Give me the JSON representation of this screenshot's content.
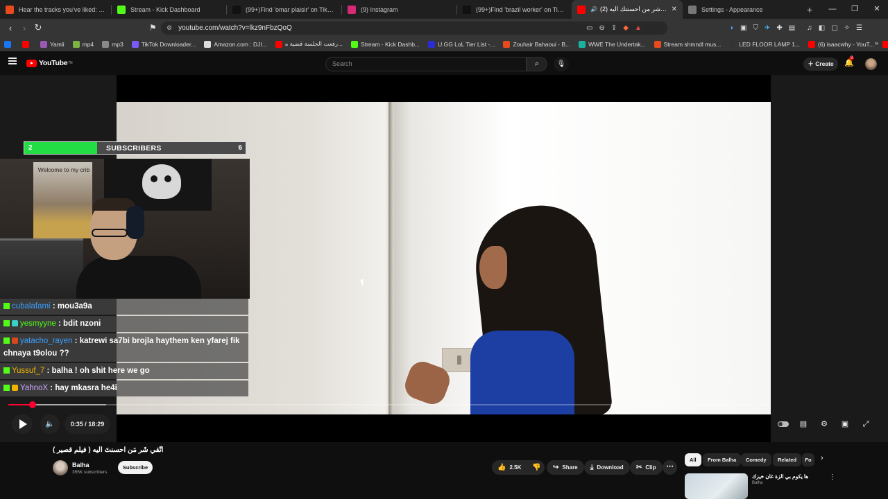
{
  "browser": {
    "tabs": [
      {
        "title": "Hear the tracks you've liked: on Sou",
        "color": "#e8491d",
        "active": false
      },
      {
        "title": "Stream - Kick Dashboard",
        "color": "#53fc18",
        "active": false
      },
      {
        "title": "(99+)Find 'omar plaisir' on TikTok | T",
        "color": "#111111",
        "active": false
      },
      {
        "title": "(9) Instagram",
        "color": "#d62976",
        "active": false
      },
      {
        "title": "(99+)Find 'brazil worker' on TikTok |",
        "color": "#111111",
        "active": false
      },
      {
        "title": "(2) القي شر من احسنتك اليه (",
        "color": "#ff0000",
        "active": true
      },
      {
        "title": "Settings - Appearance",
        "color": "#777777",
        "active": false
      }
    ],
    "new_tab_label": "+",
    "window_controls": [
      "—",
      "❐",
      "✕"
    ],
    "url": "youtube.com/watch?v=lkz9nFbzQoQ",
    "bookmarks": [
      {
        "label": "",
        "color": "#1877f2"
      },
      {
        "label": "",
        "color": "#ff0000"
      },
      {
        "label": "Yamli",
        "color": "#9b59b6"
      },
      {
        "label": "mp4",
        "color": "#7cb342"
      },
      {
        "label": "mp3",
        "color": "#888888"
      },
      {
        "label": "TikTok Downloader...",
        "color": "#7a5af8"
      },
      {
        "label": "Amazon.com : DJI...",
        "color": "#dddddd"
      },
      {
        "label": "رفعت الجلسة قضية ه...",
        "color": "#ff0000"
      },
      {
        "label": "Stream - Kick Dashb...",
        "color": "#53fc18"
      },
      {
        "label": "U.GG LoL Tier List -...",
        "color": "#2b2bd8"
      },
      {
        "label": "Zouhair Bahaoui - B...",
        "color": "#e8491d"
      },
      {
        "label": "WWE The Undertak...",
        "color": "#19b3a0"
      },
      {
        "label": "Stream shmndl mus...",
        "color": "#e8491d"
      },
      {
        "label": "LED FLOOR LAMP 1...",
        "color": "#333333"
      },
      {
        "label": "(6) isaacwhy - YouT...",
        "color": "#ff0000"
      },
      {
        "label": "st",
        "color": "#ff0000"
      }
    ]
  },
  "youtube": {
    "logo_text": "YouTube",
    "logo_sup": "TN",
    "search_placeholder": "Search",
    "create_label": "Create",
    "notification_count": "9"
  },
  "player": {
    "current_time": "0:35 / 18:29",
    "progress_fraction": 0.0316
  },
  "overlay": {
    "sub_current": "2",
    "sub_label": "SUBSCRIBERS",
    "sub_goal": "6",
    "sub_fraction": 0.33,
    "poster_text": "Welcome to my crib",
    "chat": [
      {
        "user": "cubalafami",
        "color": "#3aa0ff",
        "badge": "kick",
        "badge_color": "#53fc18",
        "message": "mou3a9a"
      },
      {
        "user": "yesmyyne",
        "color": "#53fc18",
        "badge": "sub",
        "badge_color": "#3ad1c8",
        "message": "bdit nzoni"
      },
      {
        "user": "yatacho_rayen",
        "color": "#3aa0ff",
        "badge": "hat",
        "badge_color": "#d6491f",
        "message": "katrewi sa7bi brojla haythem ken yfarej fik chnaya t9olou ??"
      },
      {
        "user": "Yussuf_7",
        "color": "#f0b400",
        "badge": "kick",
        "badge_color": "#53fc18",
        "message": "balha ! oh shit here we go"
      },
      {
        "user": "YahnoX",
        "color": "#c9a6ff",
        "badge": "crown",
        "badge_color": "#f0b400",
        "message": "hay mkasra he4i"
      }
    ]
  },
  "video": {
    "title": "اتّقي شَر مَن احسنتَ اليه ( فيلم قصير )",
    "channel": "Balha",
    "subscribers": "355K subscribers",
    "subscribe_label": "Subscribe",
    "likes": "2.5K",
    "share_label": "Share",
    "download_label": "Download",
    "clip_label": "Clip"
  },
  "sidebar": {
    "chips": [
      "All",
      "From Balha",
      "Comedy",
      "Related",
      "Fo"
    ],
    "recommendation_title": "ها يكوم بي الزة غان خيزك",
    "recommendation_channel": "Balha"
  }
}
